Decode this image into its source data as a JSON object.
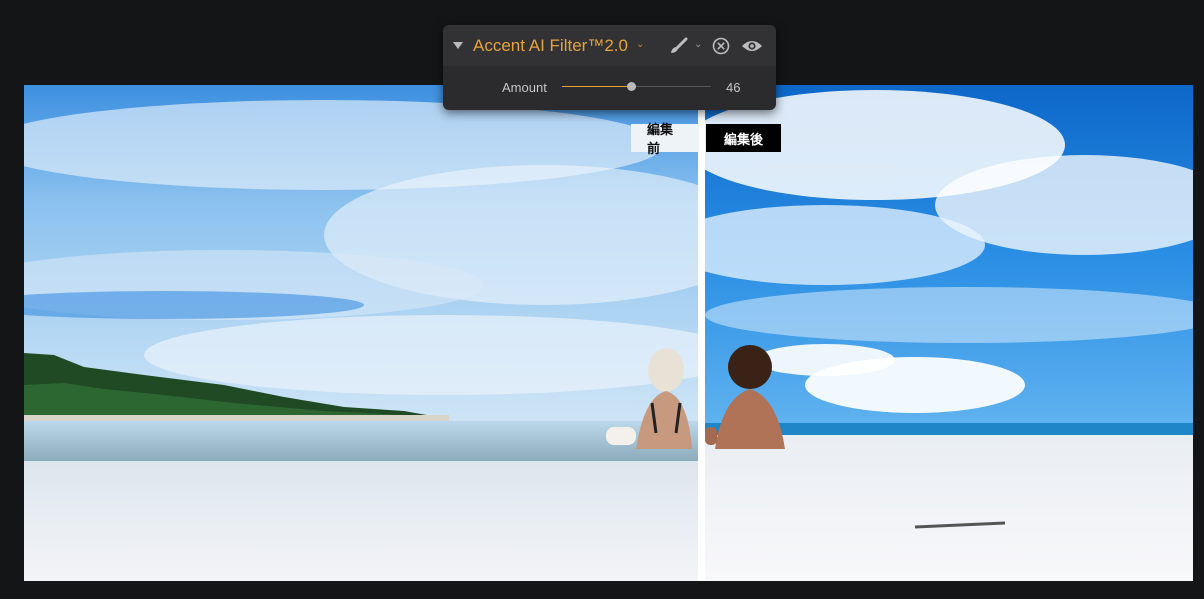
{
  "filter_panel": {
    "title": "Accent AI Filter™2.0",
    "amount_label": "Amount",
    "amount_value": "46",
    "amount_fraction": 0.46
  },
  "compare": {
    "before_label": "編集前",
    "after_label": "編集後"
  },
  "colors": {
    "accent": "#e7a33a",
    "background": "#141517"
  }
}
